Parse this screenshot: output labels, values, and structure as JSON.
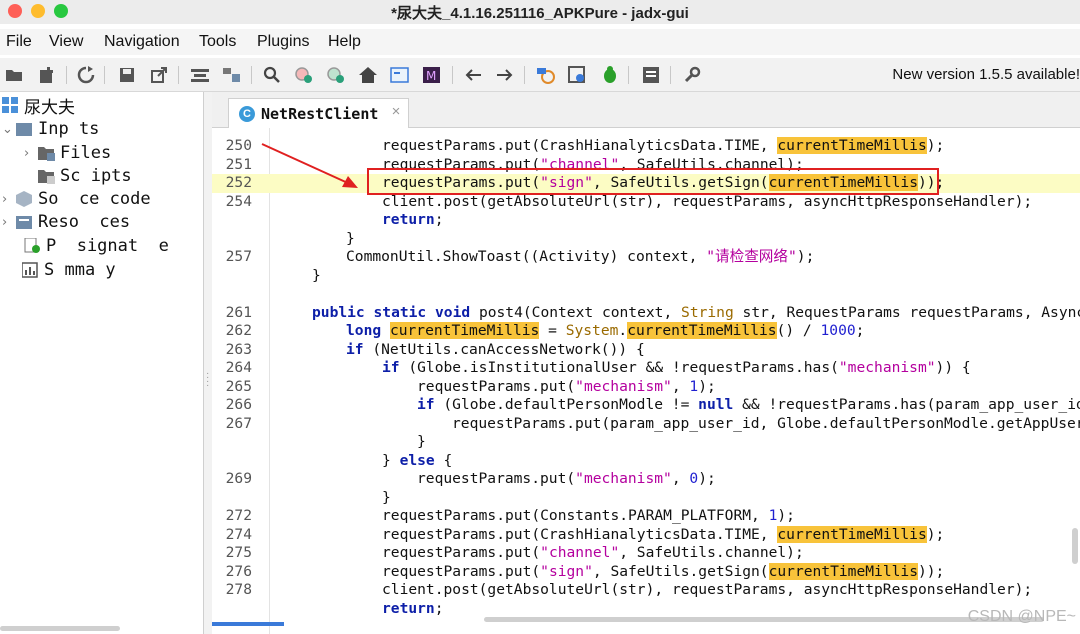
{
  "window": {
    "title": "*尿大夫_4.1.16.251116_APKPure - jadx-gui"
  },
  "menu": [
    "File",
    "View",
    "Navigation",
    "Tools",
    "Plugins",
    "Help"
  ],
  "toolbar": {
    "update_notice": "New version 1.5.5 available!"
  },
  "tree": {
    "root": "尿大夫",
    "inputs": "Inp ts",
    "files": "Files",
    "scripts": "Sc ipts",
    "source_code": "So  ce code",
    "resources": "Reso  ces",
    "signature": "P  signat  e",
    "summary": "S mma y"
  },
  "tab": {
    "label": "NetRestClient",
    "close": "×"
  },
  "code": {
    "l250": {
      "n": "250",
      "a": "requestParams.put(CrashHianalyticsData.TIME, ",
      "m": "currentTimeMillis",
      "b": ");"
    },
    "l251": {
      "n": "251",
      "a": "requestParams.put(",
      "s": "\"channel\"",
      "b": ", SafeUtils.channel);"
    },
    "l252": {
      "n": "252",
      "a": "requestParams.put(",
      "s": "\"sign\"",
      "b": ", SafeUtils.getSign(",
      "m": "currentTimeMillis",
      "c": "));"
    },
    "l254": {
      "n": "254",
      "a": "client.post(getAbsoluteUrl(str), requestParams, asyncHttpResponseHandler);"
    },
    "l254b": {
      "kw": "return",
      "b": ";"
    },
    "l254c": {
      "b": "}"
    },
    "l257": {
      "n": "257",
      "a": "CommonUtil.ShowToast((Activity) context, ",
      "s": "\"请检查网络\"",
      "b": ");"
    },
    "l257b": {
      "b": "}"
    },
    "l261": {
      "n": "261",
      "kw": "public static void",
      "a": " post4(Context context, ",
      "t": "String",
      "b": " str, RequestParams requestParams, Async"
    },
    "l262": {
      "n": "262",
      "kw": "long",
      "a": " ",
      "m": "currentTimeMillis",
      "b": " = ",
      "t": "System",
      "c": ".",
      "m2": "currentTimeMillis",
      "d": "() / ",
      "num": "1000",
      "e": ";"
    },
    "l263": {
      "n": "263",
      "kw": "if",
      "a": " (NetUtils.canAccessNetwork()) {"
    },
    "l264": {
      "n": "264",
      "kw": "if",
      "a": " (Globe.isInstitutionalUser && !requestParams.has(",
      "s": "\"mechanism\"",
      "b": ")) {"
    },
    "l265": {
      "n": "265",
      "a": "requestParams.put(",
      "s": "\"mechanism\"",
      "b": ", ",
      "num": "1",
      "c": ");"
    },
    "l266": {
      "n": "266",
      "kw": "if",
      "a": " (Globe.defaultPersonModle != ",
      "kw2": "null",
      "b": " && !requestParams.has(param_app_user_id"
    },
    "l267": {
      "n": "267",
      "a": "requestParams.put(param_app_user_id, Globe.defaultPersonModle.getAppUser"
    },
    "l267b": {
      "b": "}"
    },
    "l267c": {
      "b": "} ",
      "kw": "else",
      "c": " {"
    },
    "l269": {
      "n": "269",
      "a": "requestParams.put(",
      "s": "\"mechanism\"",
      "b": ", ",
      "num": "0",
      "c": ");"
    },
    "l269b": {
      "b": "}"
    },
    "l272": {
      "n": "272",
      "a": "requestParams.put(Constants.PARAM_PLATFORM, ",
      "num": "1",
      "b": ");"
    },
    "l274": {
      "n": "274",
      "a": "requestParams.put(CrashHianalyticsData.TIME, ",
      "m": "currentTimeMillis",
      "b": ");"
    },
    "l275": {
      "n": "275",
      "a": "requestParams.put(",
      "s": "\"channel\"",
      "b": ", SafeUtils.channel);"
    },
    "l276": {
      "n": "276",
      "a": "requestParams.put(",
      "s": "\"sign\"",
      "b": ", SafeUtils.getSign(",
      "m": "currentTimeMillis",
      "c": "));"
    },
    "l278": {
      "n": "278",
      "a": "client.post(getAbsoluteUrl(str), requestParams, asyncHttpResponseHandler);"
    },
    "l279": {
      "kw": "return",
      "b": ";"
    }
  },
  "watermark": "CSDN @NPE~",
  "colors": {
    "keyword": "#0d1fa8",
    "string": "#b4009e",
    "highlight": "#f8c33a",
    "current_line": "#fcfcc4",
    "annotation": "#e02020"
  }
}
